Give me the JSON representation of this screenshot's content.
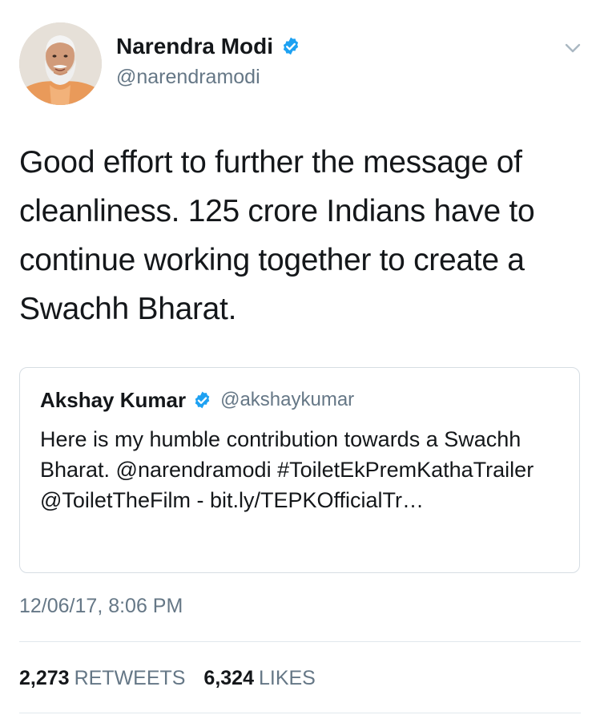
{
  "author": {
    "name": "Narendra Modi",
    "handle": "@narendramodi",
    "verified": true
  },
  "icons": {
    "avatar": "profile-photo",
    "verified": "verified-badge-icon",
    "more": "chevron-down-icon"
  },
  "colors": {
    "verified_blue": "#1da1f2",
    "secondary_text": "#657786",
    "primary_text": "#14171a",
    "border": "#e1e8ed"
  },
  "tweet": {
    "text": "Good effort to further the message of cleanliness. 125 crore Indians have to continue working together to create a Swachh Bharat."
  },
  "quoted": {
    "name": "Akshay Kumar",
    "handle": "@akshaykumar",
    "verified": true,
    "text": "Here is my humble contribution towards a Swachh Bharat. @narendramodi #ToiletEkPremKathaTrailer @ToiletTheFilm - bit.ly/TEPKOfficialTr…"
  },
  "timestamp": "12/06/17, 8:06 PM",
  "stats": {
    "retweets_count": "2,273",
    "retweets_label": "RETWEETS",
    "likes_count": "6,324",
    "likes_label": "LIKES"
  }
}
